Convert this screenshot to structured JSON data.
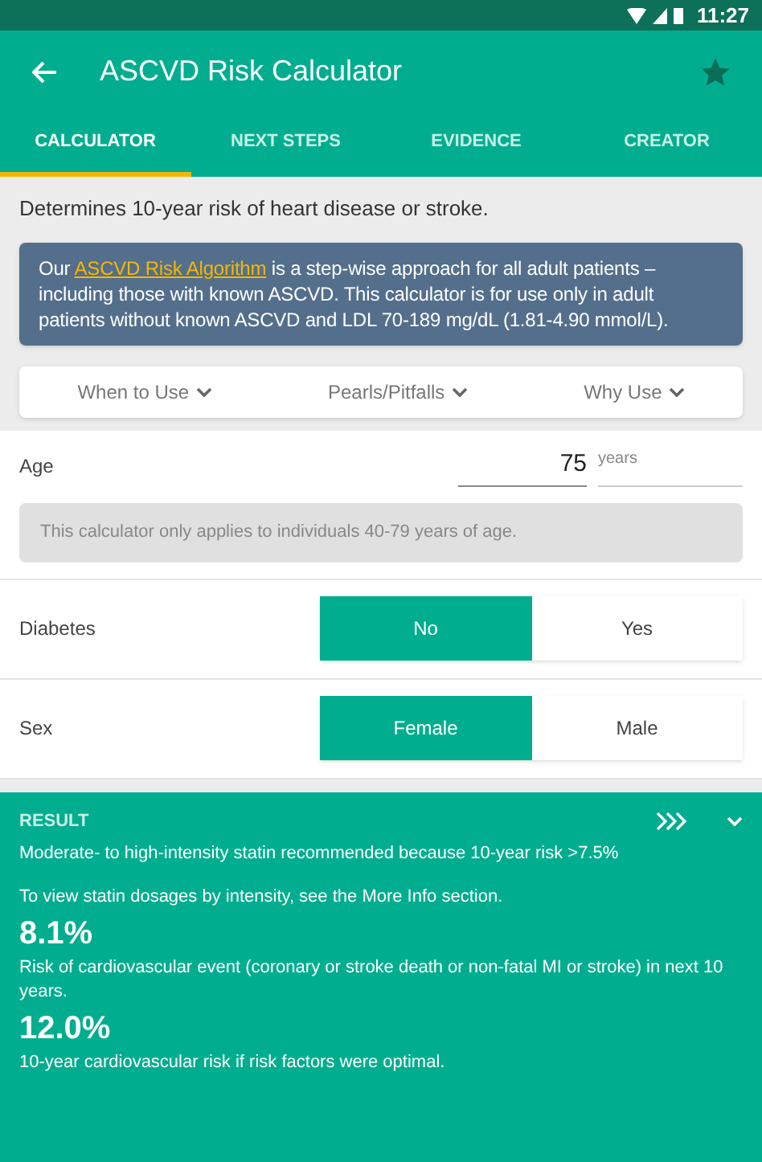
{
  "status_bar": {
    "time": "11:27"
  },
  "app_bar": {
    "title": "ASCVD Risk Calculator",
    "favorite": true
  },
  "tabs": [
    {
      "label": "CALCULATOR",
      "selected": true
    },
    {
      "label": "NEXT STEPS",
      "selected": false
    },
    {
      "label": "EVIDENCE",
      "selected": false
    },
    {
      "label": "CREATOR",
      "selected": false
    }
  ],
  "description": "Determines 10-year risk of heart disease or stroke.",
  "notice": {
    "before": "Our ",
    "link": "ASCVD Risk Algorithm",
    "after": " is a step-wise approach for all adult patients – including those with known ASCVD. This calculator is for use only in adult patients without known ASCVD and LDL 70-189 mg/dL (1.81-4.90 mmol/L)."
  },
  "info_links": [
    "When to Use",
    "Pearls/Pitfalls",
    "Why Use"
  ],
  "age": {
    "label": "Age",
    "value": "75",
    "unit": "years",
    "warning": "This calculator only applies to individuals 40-79 years of age."
  },
  "toggles": [
    {
      "label": "Diabetes",
      "options": [
        {
          "label": "No",
          "selected": true
        },
        {
          "label": "Yes",
          "selected": false
        }
      ]
    },
    {
      "label": "Sex",
      "options": [
        {
          "label": "Female",
          "selected": true
        },
        {
          "label": "Male",
          "selected": false
        }
      ]
    }
  ],
  "result": {
    "heading": "RESULT",
    "recommendation": "Moderate- to high-intensity statin recommended because 10-year risk >7.5%",
    "note": "To view statin dosages by intensity, see the More Info section.",
    "values": [
      {
        "value": "8.1%",
        "caption": "Risk of cardiovascular event (coronary or stroke death or non-fatal MI or stroke) in next 10 years."
      },
      {
        "value": "12.0%",
        "caption": "10-year cardiovascular risk if risk factors were optimal."
      }
    ]
  }
}
